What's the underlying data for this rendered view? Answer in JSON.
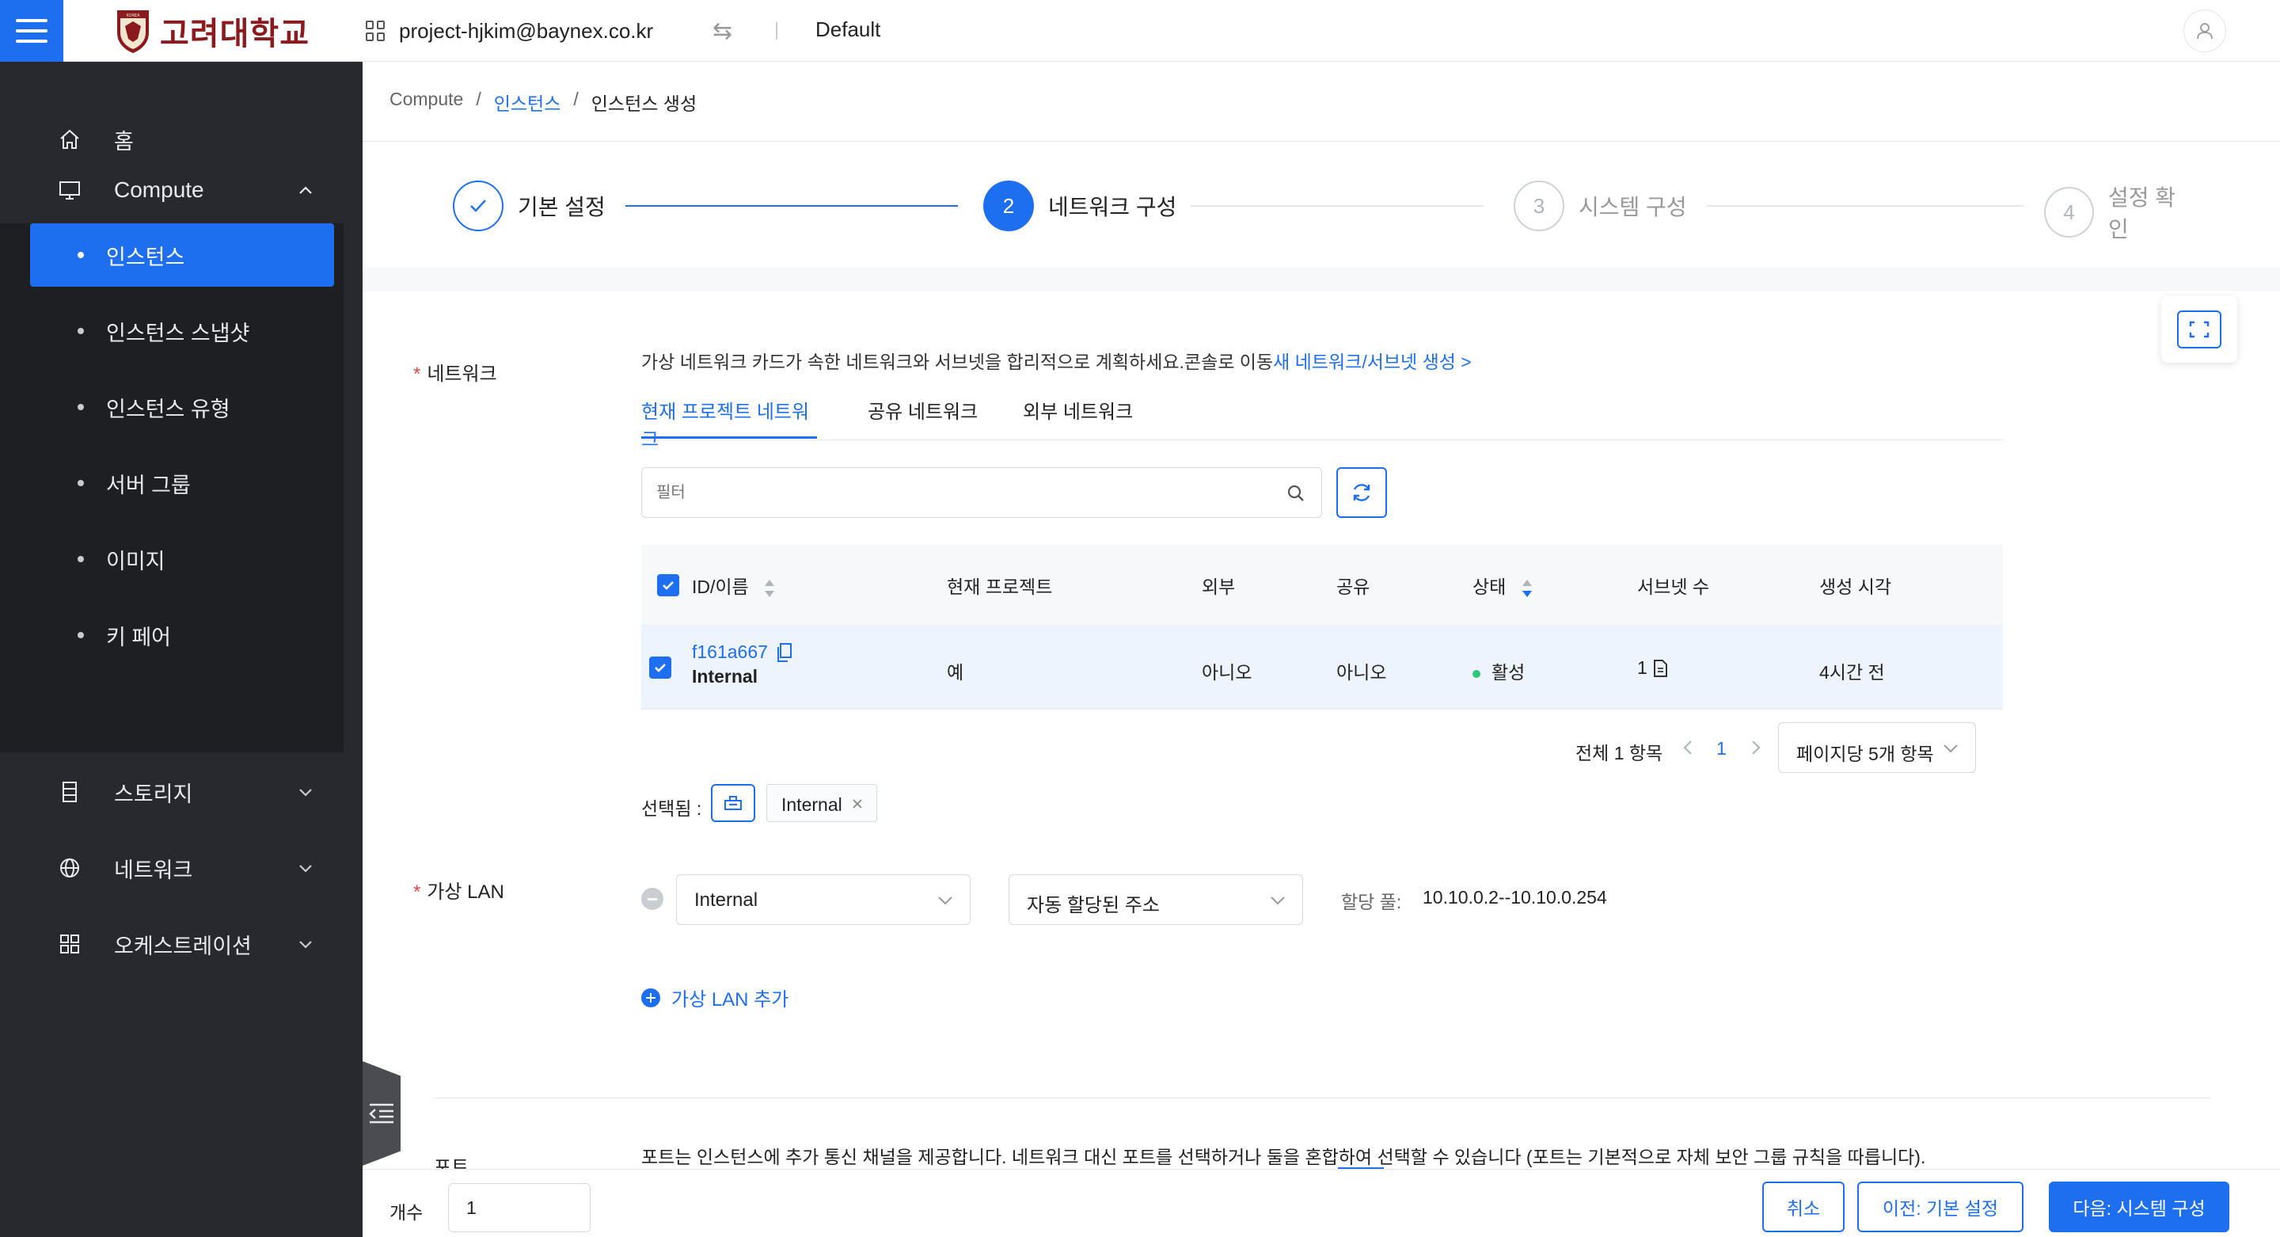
{
  "header": {
    "logo_text": "고려대학교",
    "logo_emblem_text": "KOREA",
    "project": "project-hjkim@baynex.co.kr",
    "default_label": "Default"
  },
  "sidebar": {
    "home": "홈",
    "compute": "Compute",
    "compute_items": [
      "인스턴스",
      "인스턴스 스냅샷",
      "인스턴스 유형",
      "서버 그룹",
      "이미지",
      "키 페어"
    ],
    "storage": "스토리지",
    "network": "네트워크",
    "orchestration": "오케스트레이션"
  },
  "breadcrumb": {
    "root": "Compute",
    "sep": "/",
    "parent": "인스턴스",
    "current": "인스턴스 생성"
  },
  "steps": [
    {
      "label": "기본 설정",
      "number": "1",
      "state": "done"
    },
    {
      "label": "네트워크 구성",
      "number": "2",
      "state": "current"
    },
    {
      "label": "시스템 구성",
      "number": "3",
      "state": "pending"
    },
    {
      "label": "설정 확인",
      "number": "4",
      "state": "pending"
    }
  ],
  "network_section": {
    "label": "네트워크",
    "required_mark": "*",
    "description": "가상 네트워크 카드가 속한 네트워크와 서브넷을 합리적으로 계획하세요.콘솔로 이동",
    "create_link": "새 네트워크/서브넷 생성 >",
    "tabs": [
      "현재 프로젝트 네트워크",
      "공유 네트워크",
      "외부 네트워크"
    ],
    "filter_placeholder": "필터",
    "table": {
      "headers": [
        "ID/이름",
        "현재 프로젝트",
        "외부",
        "공유",
        "상태",
        "서브넷 수",
        "생성 시각"
      ],
      "rows": [
        {
          "id": "f161a667",
          "name": "Internal",
          "current_project": "예",
          "external": "아니오",
          "shared": "아니오",
          "status": "활성",
          "subnets": "1",
          "created": "4시간 전"
        }
      ]
    },
    "pagination": {
      "total": "전체 1 항목",
      "page": "1",
      "page_size": "페이지당 5개 항목"
    },
    "selected_label": "선택됨 :",
    "selected_tag": "Internal"
  },
  "vlan_section": {
    "label": "가상 LAN",
    "required_mark": "*",
    "network_select": "Internal",
    "address_select": "자동 할당된 주소",
    "pool_label": "할당 풀:",
    "pool_value": "10.10.0.2--10.10.0.254",
    "add_label": "가상 LAN 추가"
  },
  "port_section": {
    "label": "포트",
    "description": "포트는 인스턴스에 추가 통신 채널을 제공합니다. 네트워크 대신 포트를 선택하거나 둘을 혼합하여 선택할 수 있습니다 (포트는 기본적으로 자체 보안 그룹 규칙을 따릅니다)."
  },
  "footer": {
    "count_label": "개수",
    "count_value": "1",
    "cancel": "취소",
    "prev": "이전: 기본 설정",
    "next": "다음: 시스템 구성"
  },
  "colors": {
    "primary": "#1e6ff0",
    "sidebar_bg": "#28292f",
    "submenu_bg": "#1e1f23",
    "logo": "#8b1a1e",
    "status_active": "#34c47c"
  }
}
